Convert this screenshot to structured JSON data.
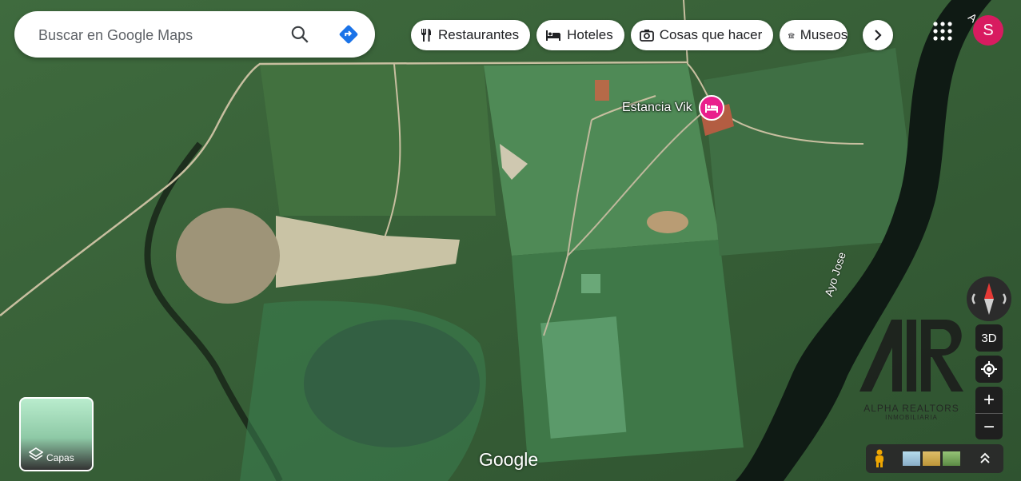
{
  "search": {
    "placeholder": "Buscar en Google Maps"
  },
  "icons": {
    "search": "search-icon",
    "directions": "directions-icon"
  },
  "chips": [
    {
      "label": "Restaurantes",
      "icon": "fork-knife-icon"
    },
    {
      "label": "Hoteles",
      "icon": "bed-icon"
    },
    {
      "label": "Cosas que hacer",
      "icon": "camera-icon"
    },
    {
      "label": "Museos",
      "icon": "museum-icon"
    }
  ],
  "account": {
    "initial": "S",
    "color": "#d81b60"
  },
  "map": {
    "place_label": "Estancia Vik",
    "river_label": "Ayo Jose",
    "river_label_top": "A",
    "watermark_brand": "ALPHA REALTORS",
    "watermark_sub": "INMOBILIARIA",
    "attribution": "Google"
  },
  "controls": {
    "tilt_label": "3D",
    "zoom_in": "+",
    "zoom_out": "−"
  },
  "layers": {
    "label": "Capas"
  },
  "colors": {
    "accent": "#1a73e8",
    "pin": "#e91e8c"
  }
}
